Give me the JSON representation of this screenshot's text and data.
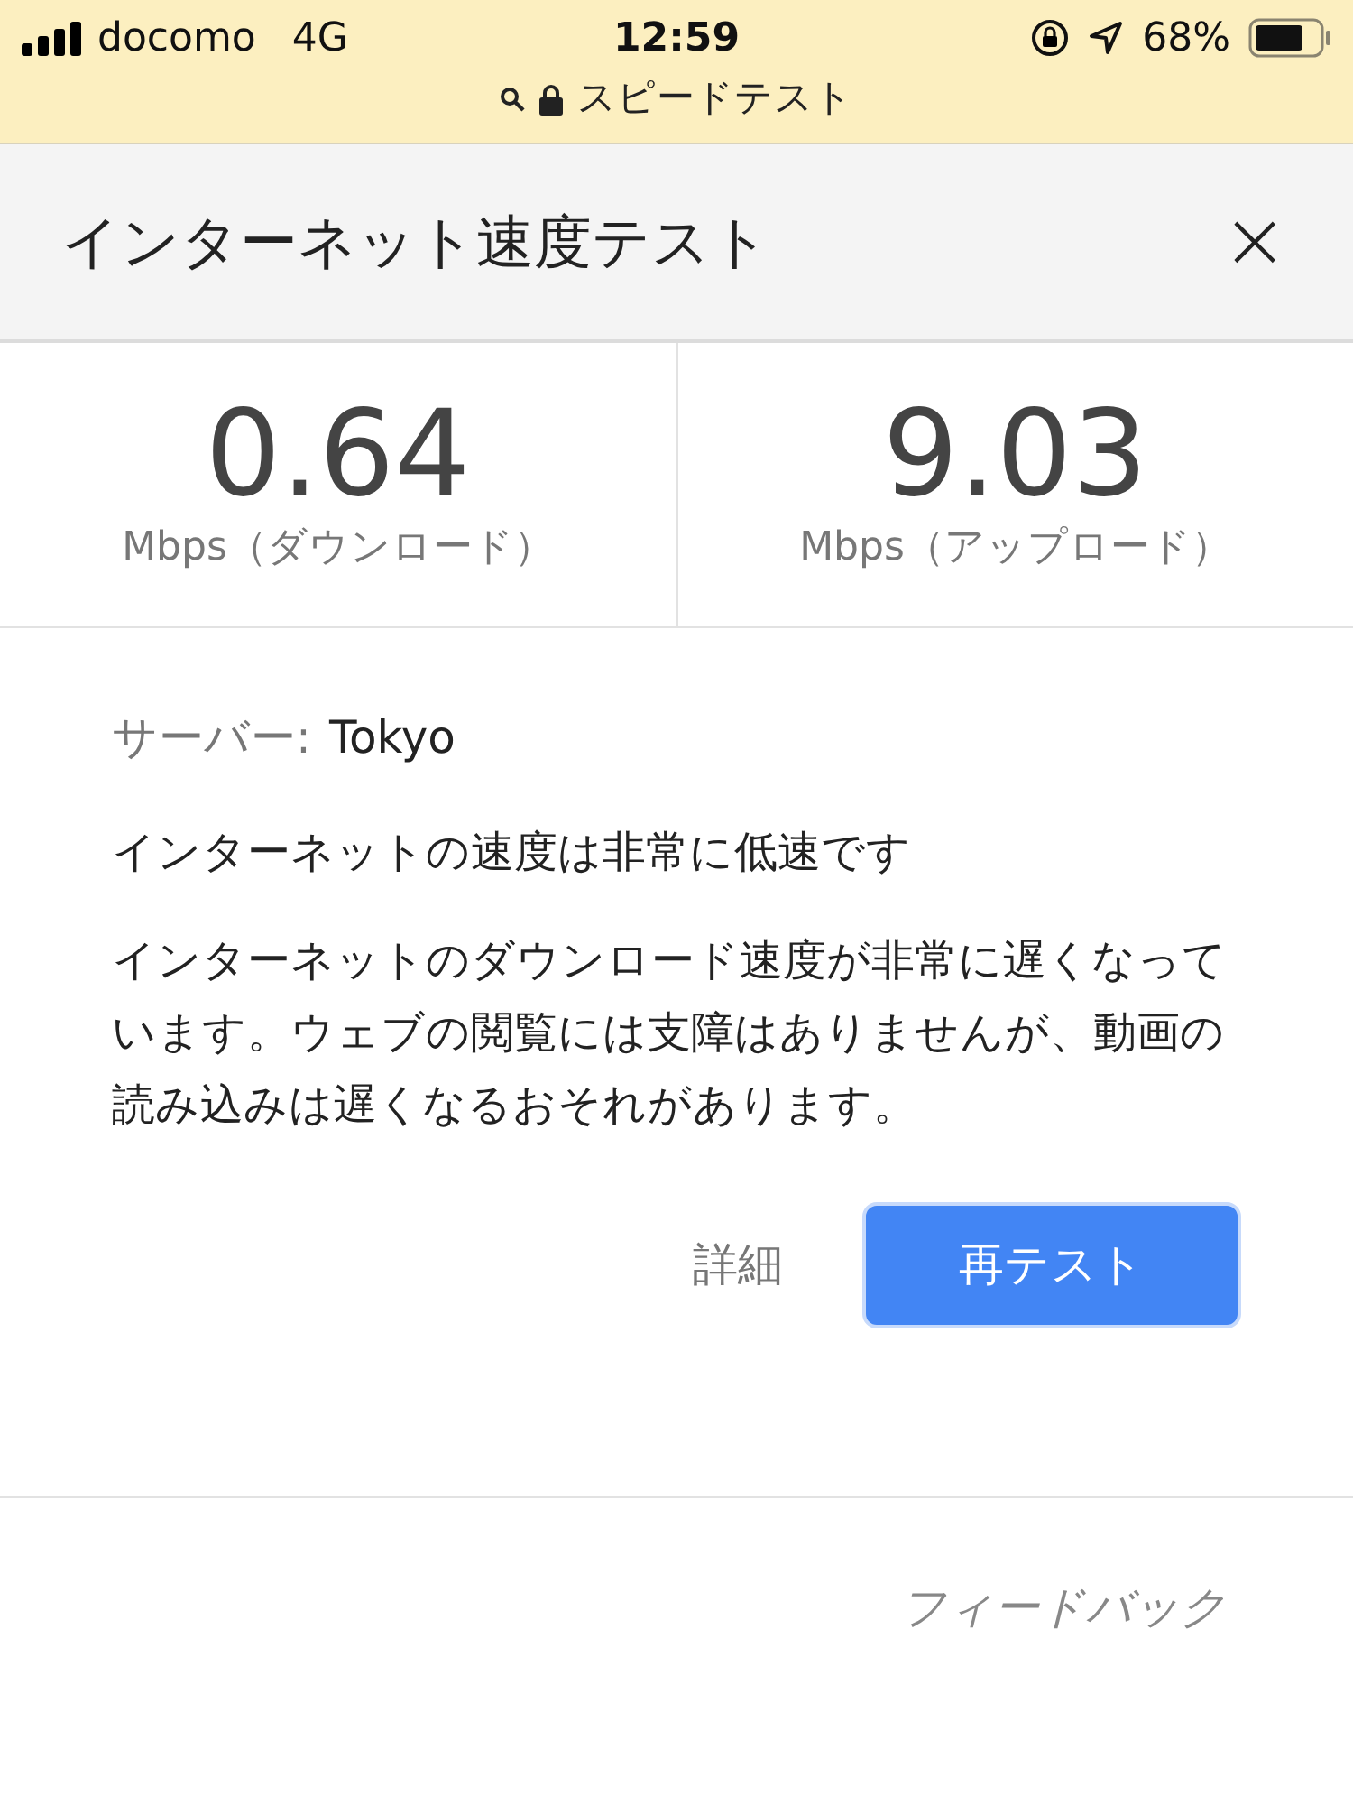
{
  "status_bar": {
    "carrier": "docomo",
    "network": "4G",
    "time": "12:59",
    "battery": "68%",
    "page_title": "スピードテスト"
  },
  "header": {
    "title": "インターネット速度テスト",
    "close": "×"
  },
  "results": [
    {
      "value": "0.64",
      "label": "Mbps（ダウンロード）"
    },
    {
      "value": "9.03",
      "label": "Mbps（アップロード）"
    }
  ],
  "server": {
    "label": "サーバー:",
    "value": "Tokyo"
  },
  "verdict": "インターネットの速度は非常に低速です",
  "description": "インターネットのダウンロード速度が非常に遅くなっています。ウェブの閲覧には支障はありませんが、動画の読み込みは遅くなるおそれがあります。",
  "buttons": [
    {
      "label": "詳細",
      "kind": "text"
    },
    {
      "label": "再テスト",
      "kind": "primary"
    }
  ],
  "feedback": "フィードバック"
}
